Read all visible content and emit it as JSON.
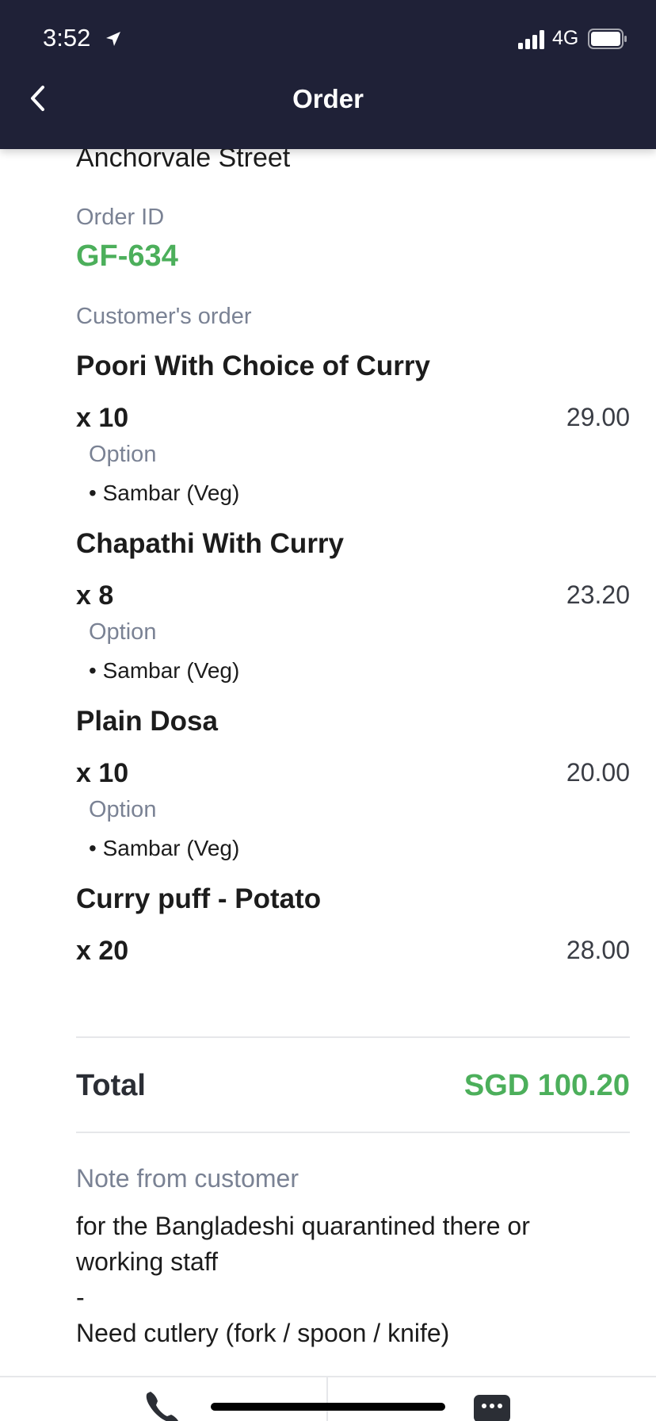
{
  "status_bar": {
    "time": "3:52",
    "network": "4G"
  },
  "header": {
    "title": "Order",
    "back_icon": "chevron-left-icon"
  },
  "address_tail": "Anchorvale Street",
  "order": {
    "id_label": "Order ID",
    "id": "GF-634",
    "customer_order_label": "Customer's order",
    "items": [
      {
        "name": "Poori With Choice of Curry",
        "qty": "x 10",
        "price": "29.00",
        "option_label": "Option",
        "option": "• Sambar (Veg)"
      },
      {
        "name": "Chapathi With Curry",
        "qty": "x 8",
        "price": "23.20",
        "option_label": "Option",
        "option": "• Sambar (Veg)"
      },
      {
        "name": "Plain Dosa",
        "qty": "x 10",
        "price": "20.00",
        "option_label": "Option",
        "option": "• Sambar (Veg)"
      },
      {
        "name": "Curry puff - Potato",
        "qty": "x 20",
        "price": "28.00"
      }
    ],
    "total_label": "Total",
    "total": "SGD 100.20"
  },
  "note": {
    "label": "Note from customer",
    "lines": [
      "for the Bangladeshi quarantined there or",
      "working staff",
      "-",
      "Need cutlery (fork / spoon / knife)"
    ]
  },
  "bottom_bar": {
    "call_icon": "phone-icon",
    "chat_icon": "chat-bubble-icon"
  },
  "colors": {
    "header_bg": "#1f2137",
    "accent_green": "#4caf5b",
    "muted_label": "#7a8294"
  }
}
